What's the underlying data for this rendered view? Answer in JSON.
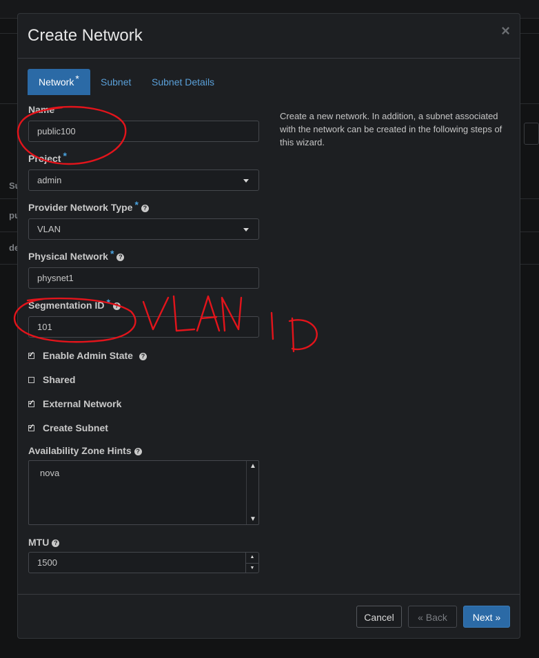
{
  "background": {
    "row_text_1": "Su",
    "row_text_2": "pu",
    "row_text_3": "de"
  },
  "modal": {
    "title": "Create Network",
    "close_glyph": "×",
    "tabs": [
      {
        "label": "Network",
        "required": "*"
      },
      {
        "label": "Subnet"
      },
      {
        "label": "Subnet Details"
      }
    ],
    "description": "Create a new network. In addition, a subnet associated with the network can be created in the following steps of this wizard.",
    "fields": {
      "name": {
        "label": "Name",
        "value": "public100"
      },
      "project": {
        "label": "Project",
        "required": "*",
        "value": "admin"
      },
      "provider_network_type": {
        "label": "Provider Network Type",
        "required": "*",
        "value": "VLAN"
      },
      "physical_network": {
        "label": "Physical Network",
        "required": "*",
        "value": "physnet1"
      },
      "segmentation_id": {
        "label": "Segmentation ID",
        "required": "*",
        "value": "101"
      },
      "availability_zone_hints": {
        "label": "Availability Zone Hints",
        "value": "nova"
      },
      "mtu": {
        "label": "MTU",
        "value": "1500"
      }
    },
    "checkboxes": [
      {
        "label": "Enable Admin State",
        "checked": true,
        "help": true
      },
      {
        "label": "Shared",
        "checked": false
      },
      {
        "label": "External Network",
        "checked": true
      },
      {
        "label": "Create Subnet",
        "checked": true
      }
    ],
    "buttons": {
      "cancel": "Cancel",
      "back": "« Back",
      "next": "Next »"
    }
  },
  "annotation": {
    "handwritten_text": "VLAN ID",
    "color": "#e3141b"
  },
  "colors": {
    "accent": "#2b6aa6",
    "link": "#5aa0d9",
    "required": "#4aa3df"
  }
}
